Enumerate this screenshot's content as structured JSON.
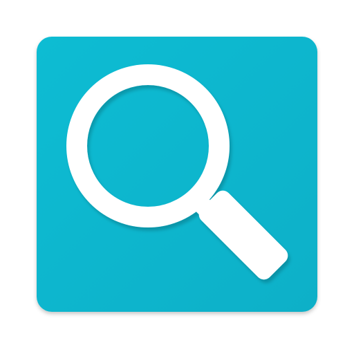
{
  "icon": {
    "name": "search-icon",
    "symbol": "magnifying-glass",
    "colors": {
      "background": "#0FBCD3",
      "background_edge": "#0AB0C8",
      "glyph": "#FFFFFF",
      "shadow": "rgba(0,0,0,0.22)"
    }
  }
}
